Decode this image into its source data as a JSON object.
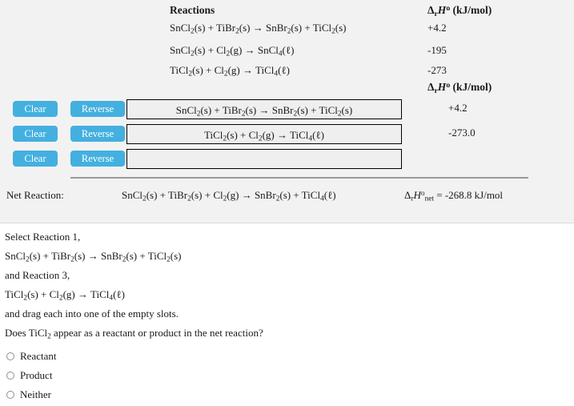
{
  "reference_table": {
    "header_reactions": "Reactions",
    "header_enthalpy": "ΔrH° (kJ/mol)",
    "rows": [
      {
        "equation": "SnCl2(s) + TiBr2(s) → SnBr2(s) + TiCl2(s)",
        "enthalpy": "+4.2"
      },
      {
        "equation": "SnCl2(s) + Cl2(g) → SnCl4(ℓ)",
        "enthalpy": "-195"
      },
      {
        "equation": "TiCl2(s) + Cl2(g) → TiCl4(ℓ)",
        "enthalpy": "-273"
      }
    ]
  },
  "slots_section": {
    "header_enthalpy": "ΔrH° (kJ/mol)",
    "clear_label": "Clear",
    "reverse_label": "Reverse",
    "rows": [
      {
        "equation": "SnCl2(s) + TiBr2(s) → SnBr2(s) + TiCl2(s)",
        "enthalpy": "+4.2"
      },
      {
        "equation": "TiCl2(s) + Cl2(g) → TiCl4(ℓ)",
        "enthalpy": "-273.0"
      },
      {
        "equation": "",
        "enthalpy": ""
      }
    ]
  },
  "net_reaction": {
    "label": "Net Reaction:",
    "equation": "SnCl2(s) + TiBr2(s) + Cl2(g) → SnBr2(s) + TiCl4(ℓ)",
    "enthalpy": "ΔrH°net = -268.8 kJ/mol"
  },
  "question": {
    "lines": [
      "Select Reaction 1,",
      "SnCl2(s) + TiBr2(s) → SnBr2(s) + TiCl2(s)",
      "and Reaction 3,",
      "TiCl2(s) + Cl2(g) → TiCl4(ℓ)",
      "and drag each into one of the empty slots.",
      "Does TiCl2 appear as a reactant or product in the net reaction?"
    ],
    "options": [
      {
        "label": "Reactant",
        "selected": false
      },
      {
        "label": "Product",
        "selected": false
      },
      {
        "label": "Neither",
        "selected": false
      }
    ]
  },
  "colors": {
    "button_blue": "#43b0e0",
    "panel_gray": "#f2f2f2",
    "slot_fill": "#efefef",
    "rule_gray": "#9a9a9a"
  }
}
